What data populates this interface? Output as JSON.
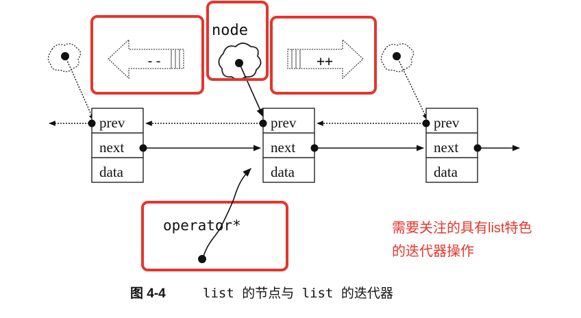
{
  "colors": {
    "highlight": "#e5352b",
    "note_text": "#e5352b",
    "ink": "#111111"
  },
  "labels": {
    "node": "node",
    "decrement": "--",
    "increment": "++",
    "operator": "operator*"
  },
  "nodes": [
    {
      "id": "left",
      "fields": [
        "prev",
        "next",
        "data"
      ]
    },
    {
      "id": "middle",
      "fields": [
        "prev",
        "next",
        "data"
      ]
    },
    {
      "id": "right",
      "fields": [
        "prev",
        "next",
        "data"
      ]
    }
  ],
  "note": {
    "line1": "需要关注的具有list特色",
    "line2": "的迭代器操作"
  },
  "caption": {
    "figure_number": "图 4-4",
    "text": "list 的节点与 list 的迭代器"
  }
}
